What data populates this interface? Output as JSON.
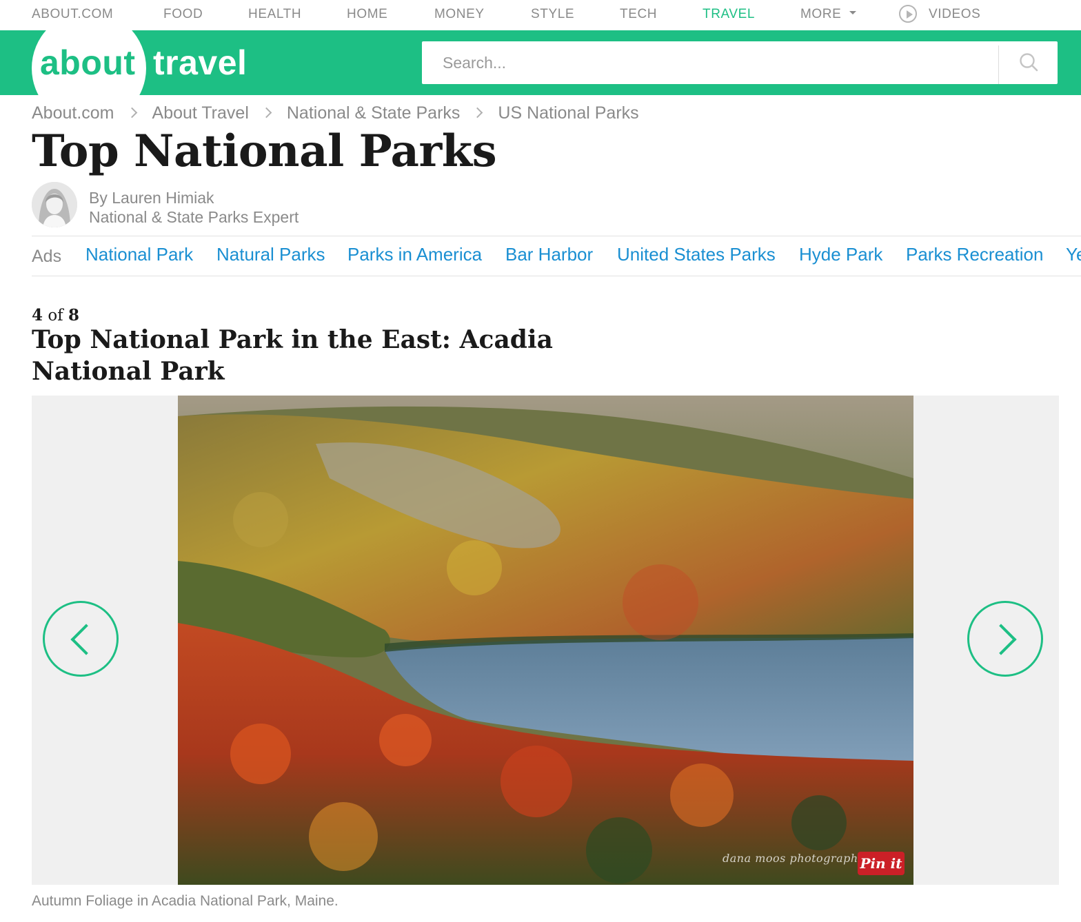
{
  "topnav": {
    "items": [
      "ABOUT.COM",
      "FOOD",
      "HEALTH",
      "HOME",
      "MONEY",
      "STYLE",
      "TECH",
      "TRAVEL",
      "MORE",
      "VIDEOS"
    ],
    "active": "TRAVEL"
  },
  "brand": {
    "about": "about",
    "travel": "travel"
  },
  "search": {
    "placeholder": "Search..."
  },
  "breadcrumb": [
    "About.com",
    "About Travel",
    "National & State Parks",
    "US National Parks"
  ],
  "page_title": "Top National Parks",
  "author": {
    "name": "By Lauren Himiak",
    "role": "National & State Parks Expert"
  },
  "ads": {
    "label": "Ads",
    "links": [
      "National Park",
      "Natural Parks",
      "Parks in America",
      "Bar Harbor",
      "United States Parks",
      "Hyde Park",
      "Parks Recreation",
      "Ye"
    ]
  },
  "slide": {
    "current": "4",
    "of": "of",
    "total": "8",
    "title": "Top National Park in the East: Acadia National Park",
    "watermark": "dana moos photography",
    "pin_label": "Pin it",
    "caption": "Autumn Foliage in Acadia National Park, Maine."
  },
  "colors": {
    "brand_green": "#1dbf84",
    "link_blue": "#1a8fd2",
    "pin_red": "#cb2027"
  },
  "icons": {
    "search": "search-icon",
    "videos": "play-circle-icon",
    "prev": "chevron-left-icon",
    "next": "chevron-right-icon"
  }
}
